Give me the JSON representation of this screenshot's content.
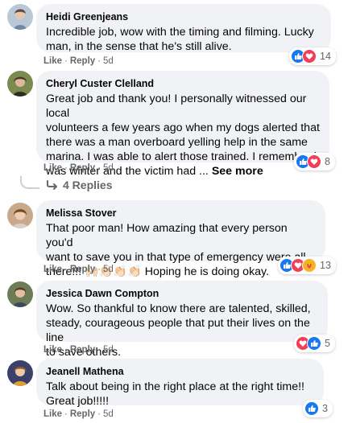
{
  "comments": [
    {
      "author": "Heidi Greenjeans",
      "lines": [
        "Incredible job, wow with the timing and filming. Lucky",
        "man, in the sense that he's still alive."
      ],
      "like": "Like",
      "reply": "Reply",
      "time": "5d",
      "reaction_count": "14",
      "reactions": [
        "like-icon",
        "love-icon"
      ]
    },
    {
      "author": "Cheryl Custer Clelland",
      "lines": [
        "Great job and thank you! I personally witnessed our local",
        "volunteers a few years ago when my dogs alerted that",
        "there was a man overboard yelling help in the same",
        "marina. I was able to alert those trained. I remember it",
        "was winter and the victim had ..."
      ],
      "see_more": "See more",
      "like": "Like",
      "reply": "Reply",
      "time": "5d",
      "reaction_count": "8",
      "reactions": [
        "like-icon",
        "love-icon"
      ]
    },
    {
      "author": "Melissa Stover",
      "lines": [
        "That poor man! How amazing that every person you'd",
        "want to save you in that type of emergency were all",
        "there!!! 🙌🏻👏🏻👏🏻👏🏻 Hoping he is doing okay."
      ],
      "like": "Like",
      "reply": "Reply",
      "time": "5d",
      "reaction_count": "13",
      "reactions": [
        "like-icon",
        "love-icon",
        "care-icon"
      ]
    },
    {
      "author": "Jessica Dawn Compton",
      "lines": [
        "Wow. So thankful to know there are talented, skilled,",
        "steady, courageous people that put their lives on the line",
        "to save others."
      ],
      "like": "Like",
      "reply": "Reply",
      "time": "5d",
      "reaction_count": "5",
      "reactions": [
        "love-icon",
        "like-icon"
      ]
    },
    {
      "author": "Jeanell Mathena",
      "lines": [
        "Talk about being in the right place at the right time!!",
        "Great job!!!!!"
      ],
      "like": "Like",
      "reply": "Reply",
      "time": "5d",
      "reaction_count": "3",
      "reactions": [
        "like-icon"
      ]
    }
  ],
  "replies_label": "4 Replies",
  "separator": "·",
  "colors": {
    "bubble": "#f0f2f5",
    "meta_text": "#65676b",
    "like_blue": "#1877f2",
    "love_red": "#f33e58",
    "care_yellow": "#f7b125"
  }
}
